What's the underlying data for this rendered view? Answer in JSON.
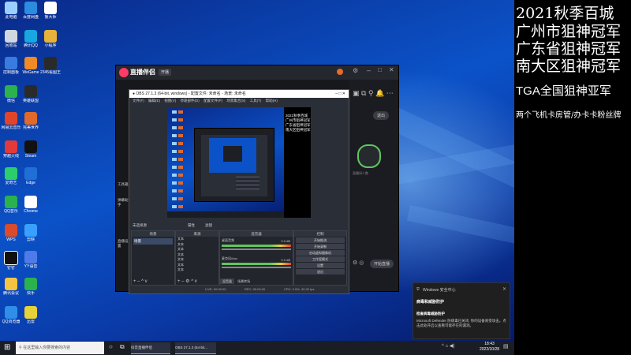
{
  "side_panel": {
    "lines": [
      "2021秋季百城",
      "广州市狙神冠军",
      "广东省狙神冠军",
      "南大区狙神冠军",
      "TGA全国狙神亚军",
      "两个飞机卡房管/办卡卡粉丝牌"
    ]
  },
  "desktop_icons": [
    "此电脑",
    "百度网盘",
    "鲁大师",
    "回收站",
    "腾讯QQ",
    "小程序",
    "控制面板",
    "微信",
    "WeGame",
    "迅雷",
    "英雄联盟",
    "2345看图王",
    "网易云音乐",
    "穿越火线",
    "完美世界",
    "Steam",
    "爱奇艺",
    "Edge",
    "QQ音乐",
    "WPS",
    "钉钉",
    "Chrome",
    "剪映",
    "YY语音",
    "腾讯会议",
    "QQ浏览器",
    "快手"
  ],
  "app_window": {
    "logo": "直播伴侣",
    "tab": "开播",
    "sidebar_items": [
      "工具箱",
      "弹幕助手",
      "直播设置"
    ],
    "right_button": "退出",
    "start_button": "开始直播",
    "chart_label": "直播间人数"
  },
  "obs": {
    "title": "OBS 27.1.3 (64-bit, windows) - 配置文件: 未命名 - 场景: 未命名",
    "menu": [
      "文件(F)",
      "编辑(E)",
      "视图(V)",
      "停靠部件(D)",
      "配置文件(P)",
      "场景集合(S)",
      "工具(T)",
      "帮助(H)"
    ],
    "preview_text": [
      "2021秋季百城",
      "广州市狙神冠军",
      "广东省狙神冠军",
      "南大区狙神冠军"
    ],
    "current_scene_label": "未选择源",
    "props_label": "属性",
    "filters_label": "滤镜",
    "docks": {
      "scenes": "场景",
      "sources": "来源",
      "mixer": "混音器",
      "transitions": "场景转场",
      "controls": "控制"
    },
    "scene_items": [
      "场景"
    ],
    "source_items": [
      "文本",
      "文本",
      "文本",
      "文本",
      "文本",
      "文本",
      "文本"
    ],
    "mixer_tracks": [
      "桌面音频",
      "麦克风/Aux"
    ],
    "mixer_levels": [
      "0.0 dB",
      "0.0 dB"
    ],
    "controls_buttons": [
      "开始推流",
      "开始录制",
      "启动虚拟摄像机",
      "工作室模式",
      "设置",
      "退出"
    ],
    "transition_tabs": [
      "混音器",
      "场景转场"
    ],
    "status": [
      "LIVE: 00:00:00",
      "REC: 00:00:00",
      "CPU: 2.9%, 30.00 fps"
    ]
  },
  "taskbar": {
    "search_placeholder": "在这里输入你要搜索的内容",
    "tasks": [
      "抖音直播伴侣",
      "OBS 27.1.3 (64-bit..."
    ],
    "clock_time": "18:43",
    "clock_date": "2022/10/28"
  },
  "toast": {
    "app": "Windows 安全中心",
    "title": "病毒和威胁防护",
    "subtitle": "检查病毒威胁防护",
    "body": "Microsoft Defender 防病毒已关闭, 你的设备易受攻击。点击此处开启以查看可能存在的漏洞。"
  },
  "colors": {
    "desktop_blue": "#0b52c8",
    "obs_bg": "#2a2e37",
    "accent_green": "#5fc65f"
  }
}
